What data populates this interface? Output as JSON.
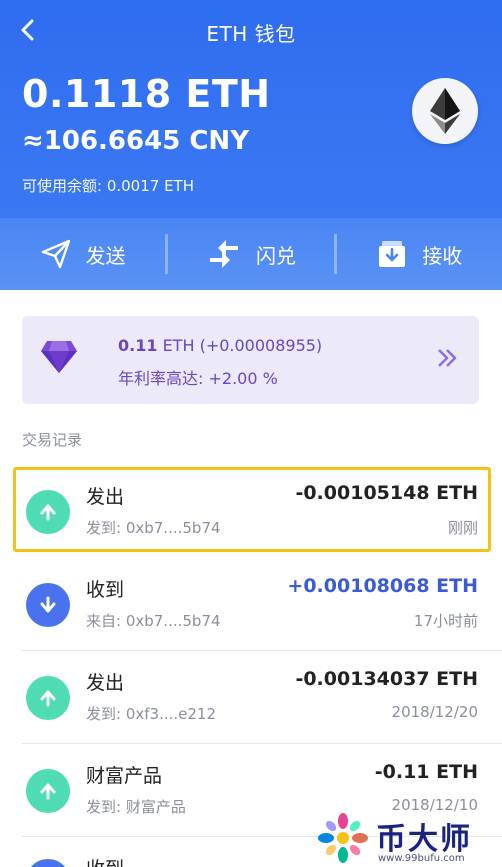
{
  "header": {
    "title": "ETH 钱包",
    "balance": "0.1118 ETH",
    "cny": "≈106.6645 CNY",
    "available": "可使用余额: 0.0017 ETH"
  },
  "actions": [
    {
      "label": "发送",
      "icon": "send-icon"
    },
    {
      "label": "闪兑",
      "icon": "swap-icon"
    },
    {
      "label": "接收",
      "icon": "receive-icon"
    }
  ],
  "promo": {
    "amount": "0.11",
    "unit": " ETH (+0.00008955)",
    "rate": "年利率高达: +2.00 %"
  },
  "section_label": "交易记录",
  "transactions": [
    {
      "type": "发出",
      "address": "发到: 0xb7....5b74",
      "amount": "-0.00105148 ETH",
      "time": "刚刚",
      "direction": "out"
    },
    {
      "type": "收到",
      "address": "来自: 0xb7....5b74",
      "amount": "+0.00108068 ETH",
      "time": "17小时前",
      "direction": "in"
    },
    {
      "type": "发出",
      "address": "发到: 0xf3....e212",
      "amount": "-0.00134037 ETH",
      "time": "2018/12/20",
      "direction": "out"
    },
    {
      "type": "财富产品",
      "address": "发到: 财富产品",
      "amount": "-0.11 ETH",
      "time": "2018/12/10",
      "direction": "out"
    },
    {
      "type": "收到",
      "address": "",
      "amount": "",
      "time": "",
      "direction": "in"
    }
  ],
  "watermark": {
    "brand": "币大师",
    "url": "www.99bufu.com"
  },
  "colors": {
    "header_blue": "#2f6df0",
    "out_green": "#4fdcb4",
    "in_blue": "#4a72ee",
    "in_amount": "#3b5bd6",
    "promo_purple": "#6b46c1",
    "highlight": "#f5c214"
  }
}
